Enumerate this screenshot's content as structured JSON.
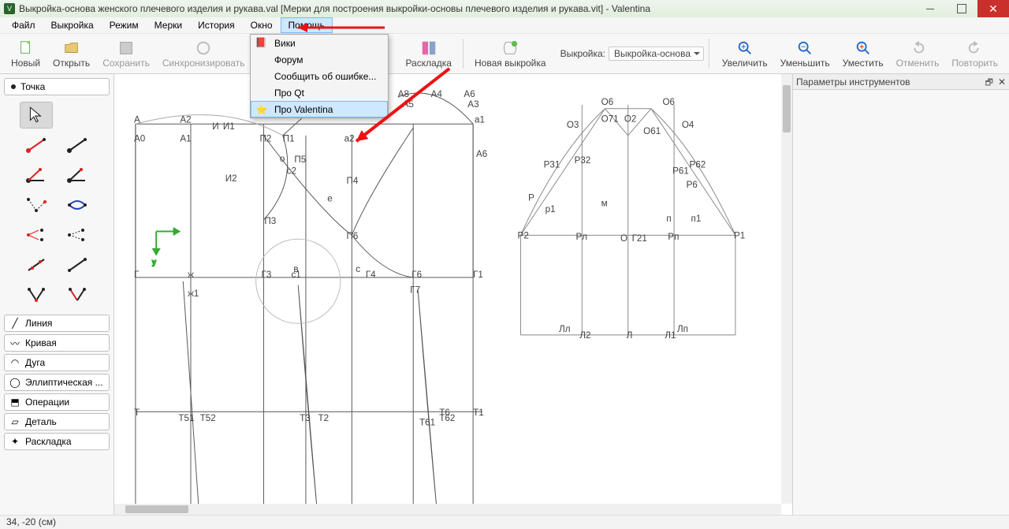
{
  "title": "Выкройка-основа женского плечевого изделия и рукава.val [Мерки для построения выкройки-основы плечевого изделия и рукава.vit] - Valentina",
  "menu": {
    "file": "Файл",
    "pattern": "Выкройка",
    "mode": "Режим",
    "meas": "Мерки",
    "history": "История",
    "window": "Окно",
    "help": "Помощь"
  },
  "helpmenu": {
    "wiki": "Вики",
    "forum": "Форум",
    "report": "Сообщить об ошибке...",
    "aboutqt": "Про Qt",
    "about": "Про Valentina"
  },
  "toolbar": {
    "new": "Новый",
    "open": "Открыть",
    "save": "Сохранить",
    "sync": "Синхронизировать",
    "layout": "Раскладка",
    "newp": "Новая выкройка",
    "patlabel": "Выкройка:",
    "patvalue": "Выкройка-основа",
    "zin": "Увеличить",
    "zout": "Уменьшить",
    "zfit": "Уместить",
    "undo": "Отменить",
    "redo": "Повторить"
  },
  "toolbox": {
    "header": "Точка"
  },
  "cats": {
    "line": "Линия",
    "curve": "Кривая",
    "arc": "Дуга",
    "ell": "Эллиптическая ...",
    "ops": "Операции",
    "detail": "Деталь",
    "layout": "Раскладка"
  },
  "params": {
    "title": "Параметры инструментов"
  },
  "status": "34, -20 (см)"
}
